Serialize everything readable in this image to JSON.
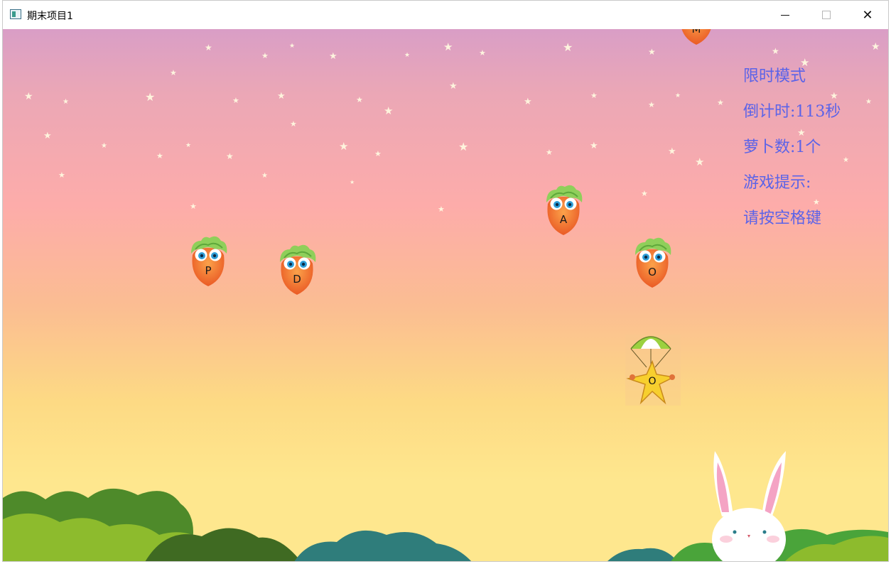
{
  "window": {
    "title": "期末项目1",
    "controls": {
      "minimize": "minimize-icon",
      "maximize": "maximize-icon",
      "close": "close-icon"
    },
    "close_glyph": "✕"
  },
  "hud": {
    "mode": "限时模式",
    "countdown_label": "倒计时:",
    "countdown_value": "113",
    "countdown_unit": "秒",
    "carrots_label": "萝卜数:",
    "carrots_value": "1",
    "carrots_unit": "个",
    "hint_label": "游戏提示:",
    "hint_text": "请按空格键"
  },
  "carrots": [
    {
      "letter": "P"
    },
    {
      "letter": "D"
    },
    {
      "letter": "A"
    },
    {
      "letter": "O"
    },
    {
      "letter": "M"
    }
  ],
  "parachute": {
    "letter": "O"
  },
  "colors": {
    "hud_text": "#5b63e8",
    "sky_top": "#d99ec6",
    "sky_mid": "#fdacaa",
    "sky_bottom": "#fee78e",
    "carrot_body": "#f26b2b",
    "carrot_leaves": "#8fcf5a"
  }
}
